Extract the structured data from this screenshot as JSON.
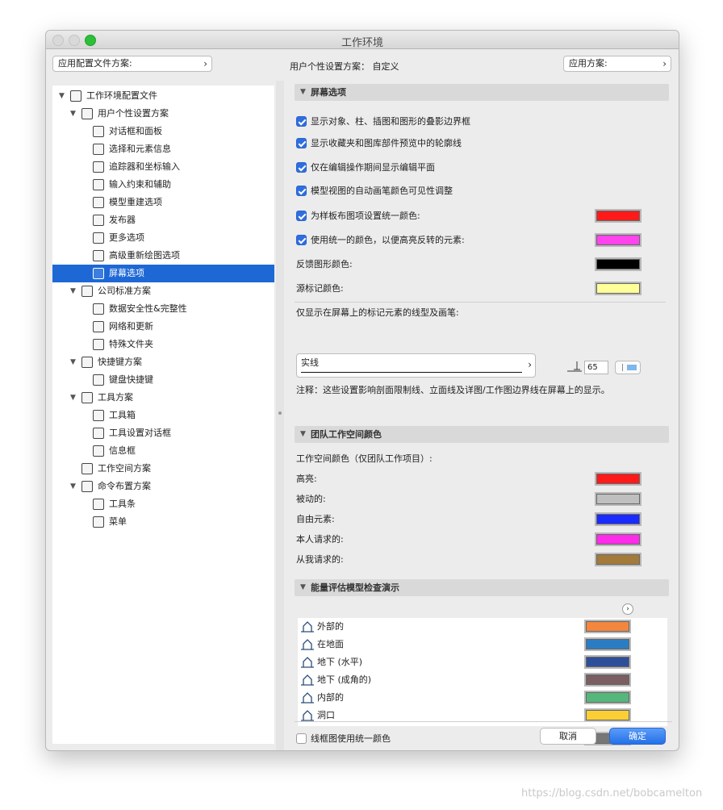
{
  "window": {
    "title": "工作环境"
  },
  "header": {
    "profile_popup": "应用配置文件方案:",
    "user_scheme_label": "用户个性设置方案：",
    "user_scheme_value": "自定义",
    "apply_popup": "应用方案:"
  },
  "tree": [
    {
      "label": "工作环境配置文件",
      "level": 0,
      "expanded": true,
      "icon": "settings-profile-icon"
    },
    {
      "label": "用户个性设置方案",
      "level": 1,
      "expanded": true,
      "icon": "user-scheme-icon"
    },
    {
      "label": "对话框和面板",
      "level": 2,
      "icon": "dialog-icon"
    },
    {
      "label": "选择和元素信息",
      "level": 2,
      "icon": "selection-icon"
    },
    {
      "label": "追踪器和坐标输入",
      "level": 2,
      "icon": "xyz-icon"
    },
    {
      "label": "输入约束和辅助",
      "level": 2,
      "icon": "mouse-icon"
    },
    {
      "label": "模型重建选项",
      "level": 2,
      "icon": "model-icon"
    },
    {
      "label": "发布器",
      "level": 2,
      "icon": "publisher-icon"
    },
    {
      "label": "更多选项",
      "level": 2,
      "icon": "sliders-icon"
    },
    {
      "label": "高级重新绘图选项",
      "level": 2,
      "icon": "redraw-icon"
    },
    {
      "label": "屏幕选项",
      "level": 2,
      "icon": "screen-icon",
      "selected": true
    },
    {
      "label": "公司标准方案",
      "level": 1,
      "expanded": true,
      "icon": "company-icon"
    },
    {
      "label": "数据安全性&完整性",
      "level": 2,
      "icon": "data-safety-icon"
    },
    {
      "label": "网络和更新",
      "level": 2,
      "icon": "globe-icon"
    },
    {
      "label": "特殊文件夹",
      "level": 2,
      "icon": "folder-icon"
    },
    {
      "label": "快捷键方案",
      "level": 1,
      "expanded": true,
      "icon": "shortcut-scheme-icon"
    },
    {
      "label": "键盘快捷键",
      "level": 2,
      "icon": "shortcut-icon"
    },
    {
      "label": "工具方案",
      "level": 1,
      "expanded": true,
      "icon": "tool-scheme-icon"
    },
    {
      "label": "工具箱",
      "level": 2,
      "icon": "toolbox-icon"
    },
    {
      "label": "工具设置对话框",
      "level": 2,
      "icon": "tool-settings-icon"
    },
    {
      "label": "信息框",
      "level": 2,
      "icon": "info-box-icon"
    },
    {
      "label": "工作空间方案",
      "level": 1,
      "icon": "workspace-icon"
    },
    {
      "label": "命令布置方案",
      "level": 1,
      "expanded": true,
      "icon": "command-scheme-icon"
    },
    {
      "label": "工具条",
      "level": 2,
      "icon": "toolbar-icon"
    },
    {
      "label": "菜单",
      "level": 2,
      "icon": "menu-icon"
    }
  ],
  "screen_options": {
    "title": "屏幕选项",
    "checkboxes": [
      {
        "label": "显示对象、柱、插图和图形的叠影边界框",
        "checked": true
      },
      {
        "label": "显示收藏夹和图库部件预览中的轮廓线",
        "checked": true
      },
      {
        "label": "仅在编辑操作期间显示编辑平面",
        "checked": true
      },
      {
        "label": "模型视图的自动画笔颜色可见性调整",
        "checked": true
      }
    ],
    "color_rows": [
      {
        "label": "为样板布图项设置统一颜色:",
        "checkbox": true,
        "checked": true,
        "color": "#ff1a1a"
      },
      {
        "label": "使用统一的颜色，以便高亮反转的元素:",
        "checkbox": true,
        "checked": true,
        "color": "#ff44ee"
      },
      {
        "label": "反馈图形颜色:",
        "checkbox": false,
        "color": "#000000"
      },
      {
        "label": "源标记颜色:",
        "checkbox": false,
        "color": "#ffff99"
      }
    ],
    "marker_line_label": "仅显示在屏幕上的标记元素的线型及画笔:",
    "line_type": "实线",
    "pen_number": "65",
    "note": "注释：这些设置影响剖面限制线、立面线及详图/工作图边界线在屏幕上的显示。"
  },
  "team_colors": {
    "title": "团队工作空间颜色",
    "subtitle": "工作空间颜色（仅团队工作项目）:",
    "rows": [
      {
        "label": "高亮:",
        "color": "#ff1a1a"
      },
      {
        "label": "被动的:",
        "color": "#bfbfbf"
      },
      {
        "label": "自由元素:",
        "color": "#1a2bff"
      },
      {
        "label": "本人请求的:",
        "color": "#ff2bea"
      },
      {
        "label": "从我请求的:",
        "color": "#a37a3a"
      }
    ]
  },
  "energy": {
    "title": "能量评估模型检查演示",
    "items": [
      {
        "label": "外部的",
        "color": "#f2873d",
        "icon": "exterior-icon"
      },
      {
        "label": "在地面",
        "color": "#2b7dc3",
        "icon": "on-grade-icon"
      },
      {
        "label": "地下 (水平)",
        "color": "#2e4e9a",
        "icon": "underground-horizontal-icon"
      },
      {
        "label": "地下 (成角的)",
        "color": "#7a5e62",
        "icon": "underground-angled-icon"
      },
      {
        "label": "内部的",
        "color": "#55b77b",
        "icon": "interior-icon"
      },
      {
        "label": "洞口",
        "color": "#fbcf34",
        "icon": "opening-icon"
      }
    ],
    "wireframe_label": "线框图使用统一颜色",
    "wireframe_checked": false,
    "wireframe_color": "#777777"
  },
  "buttons": {
    "cancel": "取消",
    "ok": "确定"
  },
  "watermark": "https://blog.csdn.net/bobcamelton"
}
